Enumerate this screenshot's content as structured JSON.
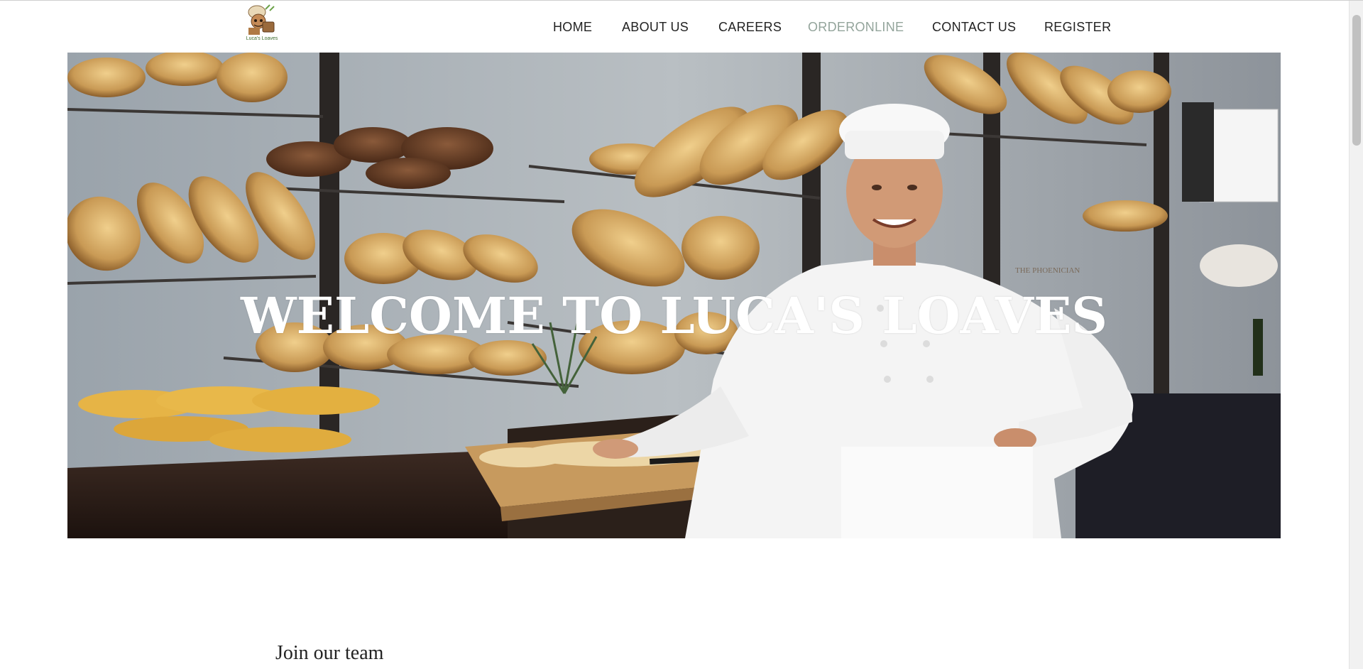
{
  "header": {
    "logo_alt": "Luca's Loaves",
    "nav": [
      {
        "label": "HOME"
      },
      {
        "label": "ABOUT US"
      },
      {
        "label": "CAREERS"
      },
      {
        "label": "ORDERONLINE",
        "active": true
      },
      {
        "label": "CONTACT US"
      },
      {
        "label": "REGISTER"
      }
    ]
  },
  "hero": {
    "title": "WELCOME TO LUCA'S LOAVES"
  },
  "section": {
    "heading": "Join our team"
  },
  "colors": {
    "nav_text": "#222222",
    "nav_active": "#93a49b",
    "hero_title": "#ffffff"
  }
}
